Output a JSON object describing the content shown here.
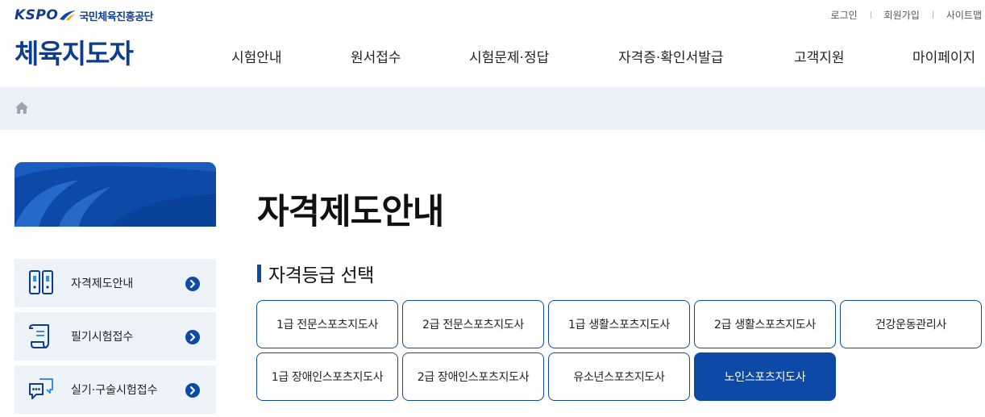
{
  "brand": {
    "logo_text": "KSPO",
    "org_name": "국민체육진흥공단",
    "site_title": "체육지도자",
    "colors": {
      "primary": "#0d4aa8",
      "dark": "#0d3d8c",
      "band": "#eaf1f8"
    }
  },
  "util_links": [
    "로그인",
    "회원가입",
    "사이트맵"
  ],
  "gnb": [
    "시험안내",
    "원서접수",
    "시험문제·정답",
    "자격증·확인서발급",
    "고객지원",
    "마이페이지"
  ],
  "breadcrumb": {
    "icon": "home-icon"
  },
  "sidebar": {
    "items": [
      {
        "label": "자격제도안내",
        "icon": "certificate-doc-icon"
      },
      {
        "label": "필기시험접수",
        "icon": "scroll-doc-icon"
      },
      {
        "label": "실기·구술시험접수",
        "icon": "chat-bubbles-icon"
      }
    ]
  },
  "main": {
    "page_title": "자격제도안내",
    "section_title": "자격등급 선택",
    "grades": [
      {
        "label": "1급 전문스포츠지도사",
        "active": false
      },
      {
        "label": "2급 전문스포츠지도사",
        "active": false
      },
      {
        "label": "1급 생활스포츠지도사",
        "active": false
      },
      {
        "label": "2급 생활스포츠지도사",
        "active": false
      },
      {
        "label": "건강운동관리사",
        "active": false
      },
      {
        "label": "1급 장애인스포츠지도사",
        "active": false
      },
      {
        "label": "2급 장애인스포츠지도사",
        "active": false
      },
      {
        "label": "유소년스포츠지도사",
        "active": false
      },
      {
        "label": "노인스포츠지도사",
        "active": true
      }
    ]
  }
}
